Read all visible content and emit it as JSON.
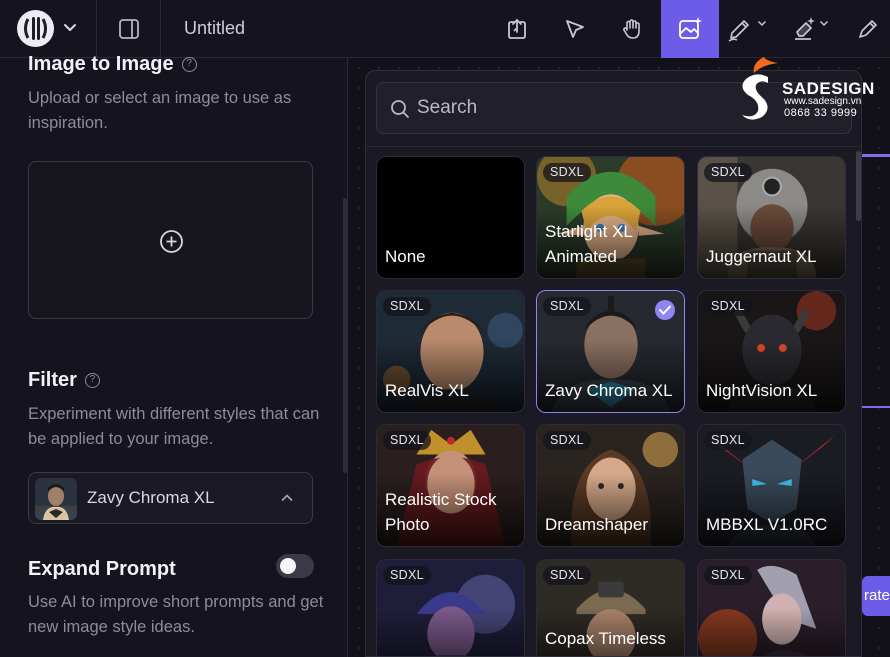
{
  "app": {
    "doc_title": "Untitled"
  },
  "toolbar": {
    "tools": [
      {
        "name": "export-icon"
      },
      {
        "name": "select-arrow-icon"
      },
      {
        "name": "pan-hand-icon"
      },
      {
        "name": "image-generate-icon",
        "active": true
      },
      {
        "name": "pen-icon",
        "has_menu": true
      },
      {
        "name": "eraser-icon",
        "has_menu": true
      },
      {
        "name": "brush-icon"
      }
    ],
    "accent_color": "#6c5ce7"
  },
  "left_panel": {
    "image_to_image": {
      "title": "Image to Image",
      "description": "Upload or select an image to use as inspiration."
    },
    "filter": {
      "title": "Filter",
      "description": "Experiment with different styles that can be applied to your image.",
      "selected": "Zavy Chroma XL"
    },
    "expand_prompt": {
      "title": "Expand Prompt",
      "description": "Use AI to improve short prompts and get new image style ideas.",
      "enabled": false
    }
  },
  "dropdown": {
    "search_placeholder": "Search",
    "models": [
      {
        "label": "None",
        "badge": "",
        "selected": false
      },
      {
        "label": "Starlight XL Animated",
        "badge": "SDXL",
        "selected": false
      },
      {
        "label": "Juggernaut XL",
        "badge": "SDXL",
        "selected": false
      },
      {
        "label": "RealVis XL",
        "badge": "SDXL",
        "selected": false
      },
      {
        "label": "Zavy Chroma XL",
        "badge": "SDXL",
        "selected": true
      },
      {
        "label": "NightVision XL",
        "badge": "SDXL",
        "selected": false
      },
      {
        "label": "Realistic Stock Photo",
        "badge": "SDXL",
        "selected": false
      },
      {
        "label": "Dreamshaper",
        "badge": "SDXL",
        "selected": false
      },
      {
        "label": "MBBXL V1.0RC",
        "badge": "SDXL",
        "selected": false
      },
      {
        "label": "",
        "badge": "SDXL",
        "selected": false
      },
      {
        "label": "Copax Timeless",
        "badge": "SDXL",
        "selected": false
      },
      {
        "label": "",
        "badge": "SDXL",
        "selected": false
      }
    ]
  },
  "canvas": {
    "generate_button_partial": "rate"
  },
  "watermark": {
    "name": "SADESIGN",
    "url": "www.sadesign.vn",
    "phone": "0868 33 9999"
  }
}
